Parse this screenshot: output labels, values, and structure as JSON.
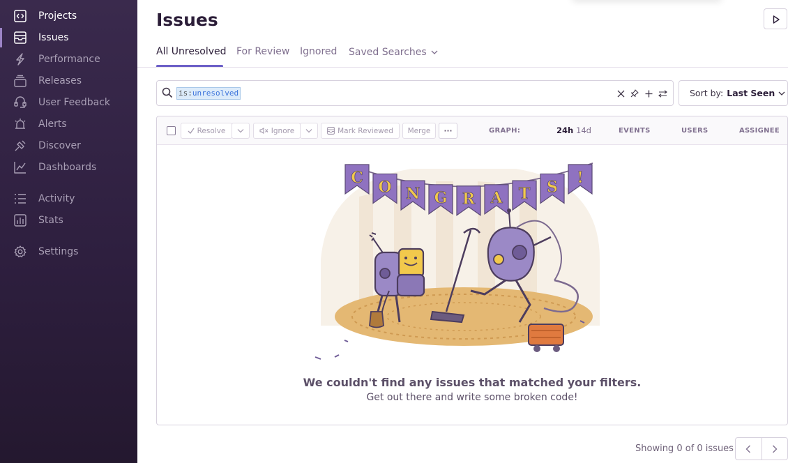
{
  "sidebar": {
    "items": [
      {
        "label": "Projects",
        "icon": "projects-icon"
      },
      {
        "label": "Issues",
        "icon": "issues-icon"
      },
      {
        "label": "Performance",
        "icon": "performance-icon"
      },
      {
        "label": "Releases",
        "icon": "releases-icon"
      },
      {
        "label": "User Feedback",
        "icon": "user-feedback-icon"
      },
      {
        "label": "Alerts",
        "icon": "alerts-icon"
      },
      {
        "label": "Discover",
        "icon": "discover-icon"
      },
      {
        "label": "Dashboards",
        "icon": "dashboards-icon"
      },
      {
        "label": "Activity",
        "icon": "activity-icon"
      },
      {
        "label": "Stats",
        "icon": "stats-icon"
      },
      {
        "label": "Settings",
        "icon": "settings-icon"
      }
    ],
    "active": "Issues"
  },
  "header": {
    "title": "Issues"
  },
  "tabs": [
    {
      "label": "All Unresolved",
      "active": true
    },
    {
      "label": "For Review",
      "active": false
    },
    {
      "label": "Ignored",
      "active": false
    },
    {
      "label": "Saved Searches",
      "active": false
    }
  ],
  "search": {
    "key": "is",
    "sep": ":",
    "value": "unresolved"
  },
  "sort": {
    "label": "Sort by:",
    "value": "Last Seen"
  },
  "toolbar": {
    "resolve": "Resolve",
    "ignore": "Ignore",
    "mark_reviewed": "Mark Reviewed",
    "merge": "Merge",
    "more": "···"
  },
  "columns": {
    "graph": "GRAPH:",
    "graph_24h": "24h",
    "graph_14d": "14d",
    "events": "EVENTS",
    "users": "USERS",
    "assignee": "ASSIGNEE"
  },
  "banner_letters": [
    "C",
    "O",
    "N",
    "G",
    "R",
    "A",
    "T",
    "S",
    "!"
  ],
  "empty": {
    "title": "We couldn't find any issues that matched your filters.",
    "subtitle": "Get out there and write some broken code!"
  },
  "footer": {
    "showing": "Showing 0 of 0 issues"
  },
  "colors": {
    "accent": "#6c5fc7",
    "sidebar_bg": "#2e1f3f",
    "banner_purple": "#8f72c0",
    "banner_yellow": "#f2c94c"
  }
}
